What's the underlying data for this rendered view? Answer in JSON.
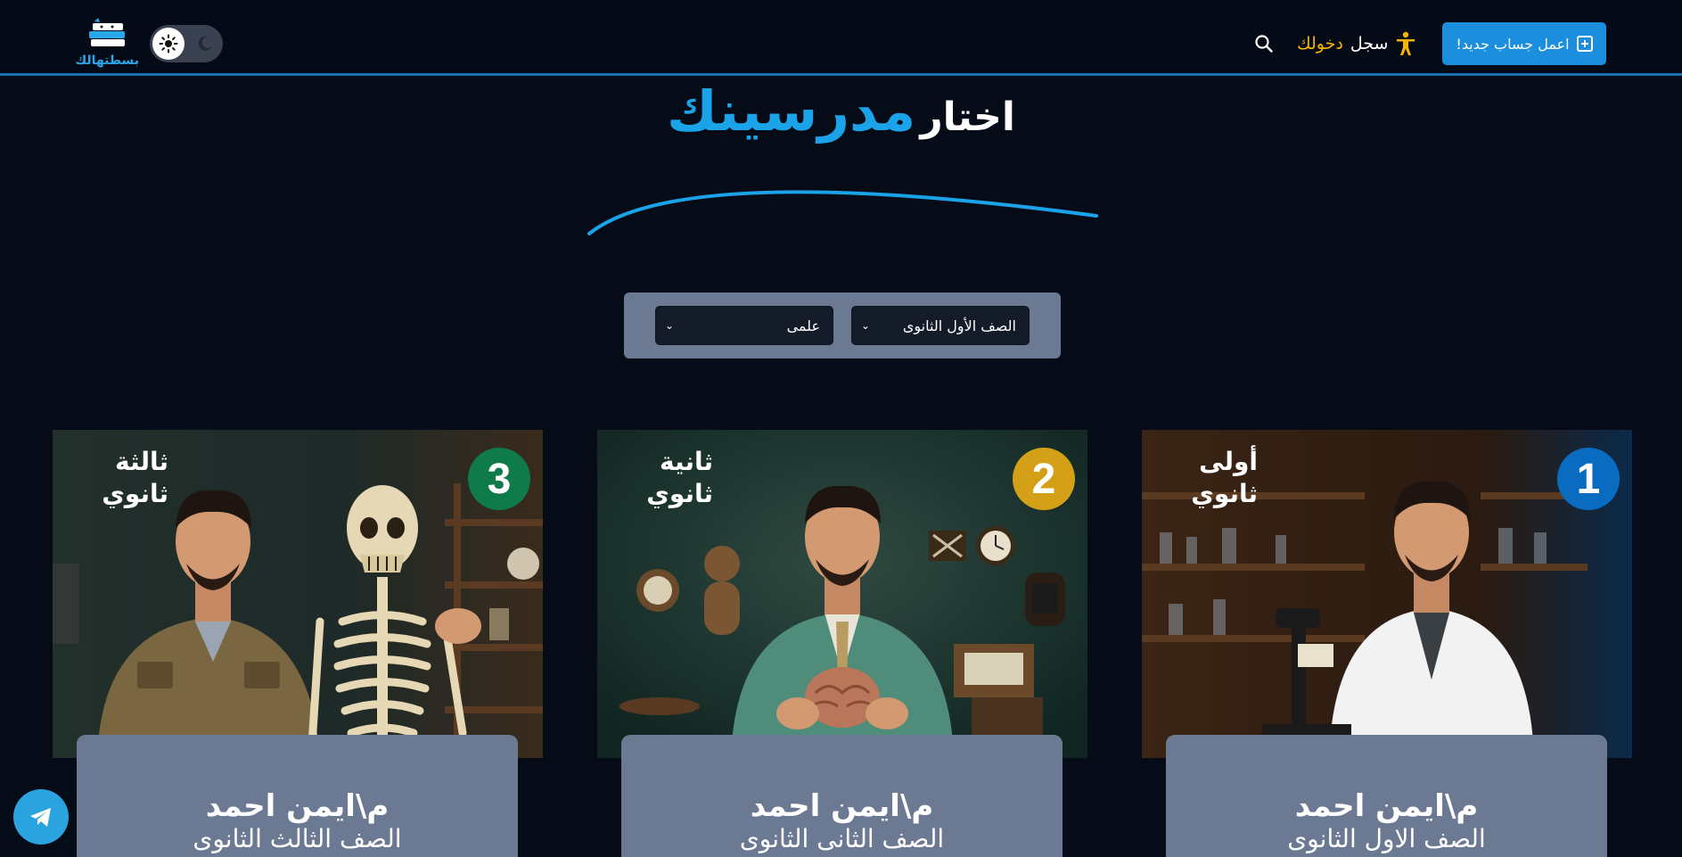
{
  "header": {
    "signup_label": "اعمل جساب جديد!",
    "login_word1": "سجل",
    "login_word2": "دخولك",
    "logo_text": "بسطتهالك"
  },
  "hero": {
    "title_part1": "اختار",
    "title_part2": "مدرسينك"
  },
  "filters": {
    "grade_selected": "الصف الأول الثانوى",
    "track_selected": "علمى"
  },
  "cards": [
    {
      "number": "1",
      "badge_color": "#0a6cc0",
      "corner_line1": "أولى",
      "corner_line2": "ثانوي",
      "name": "م\\ايمن احمد",
      "grade": "الصف الاول الثانوى"
    },
    {
      "number": "2",
      "badge_color": "#d4a017",
      "corner_line1": "ثانية",
      "corner_line2": "ثانوي",
      "name": "م\\ايمن احمد",
      "grade": "الصف الثانى الثانوى"
    },
    {
      "number": "3",
      "badge_color": "#0f7a4a",
      "corner_line1": "ثالثة",
      "corner_line2": "ثانوي",
      "name": "م\\ايمن احمد",
      "grade": "الصف الثالث الثانوى"
    }
  ],
  "colors": {
    "background": "#060b18",
    "accent": "#1aa3e8",
    "card_panel": "#6b7a92",
    "login_highlight": "#f4b400"
  },
  "icons": [
    "person-icon",
    "search-icon",
    "sun-icon",
    "moon-icon",
    "add-square-icon",
    "telegram-icon"
  ]
}
